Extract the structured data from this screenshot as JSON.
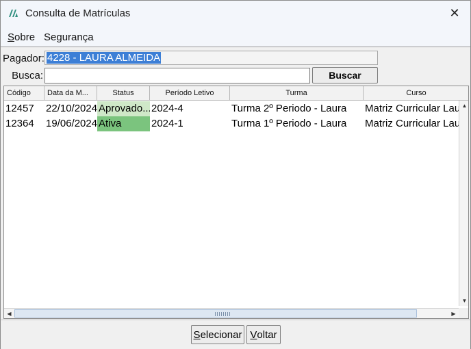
{
  "window": {
    "title": "Consulta de Matrículas",
    "close_glyph": "✕"
  },
  "menu": {
    "items": [
      {
        "label_mnemonic": "S",
        "label_rest": "obre"
      },
      {
        "label": "Segurança"
      }
    ]
  },
  "form": {
    "pagador_label": "Pagador:",
    "pagador_value": "4228 - LAURA ALMEIDA",
    "busca_label": "Busca:",
    "busca_value": "",
    "buscar_button": "Buscar"
  },
  "table": {
    "columns": [
      "Código",
      "Data da M...",
      "Status",
      "Período Letivo",
      "Turma",
      "Curso"
    ],
    "rows": [
      {
        "codigo": "12457",
        "data": "22/10/2024",
        "status": "Aprovado...",
        "periodo": "2024-4",
        "turma": "Turma 2º Periodo - Laura",
        "curso": "Matriz Curricular Laur"
      },
      {
        "codigo": "12364",
        "data": "19/06/2024",
        "status": "Ativa",
        "periodo": "2024-1",
        "turma": "Turma 1º Periodo - Laura",
        "curso": "Matriz Curricular Laur"
      }
    ]
  },
  "footer": {
    "selecionar_mnemonic": "S",
    "selecionar_rest": "elecionar",
    "voltar_mnemonic": "V",
    "voltar_rest": "oltar"
  },
  "colors": {
    "status_aprovado": "#cfe8c8",
    "status_ativa": "#7bc47e",
    "selection": "#3d7fd6"
  }
}
